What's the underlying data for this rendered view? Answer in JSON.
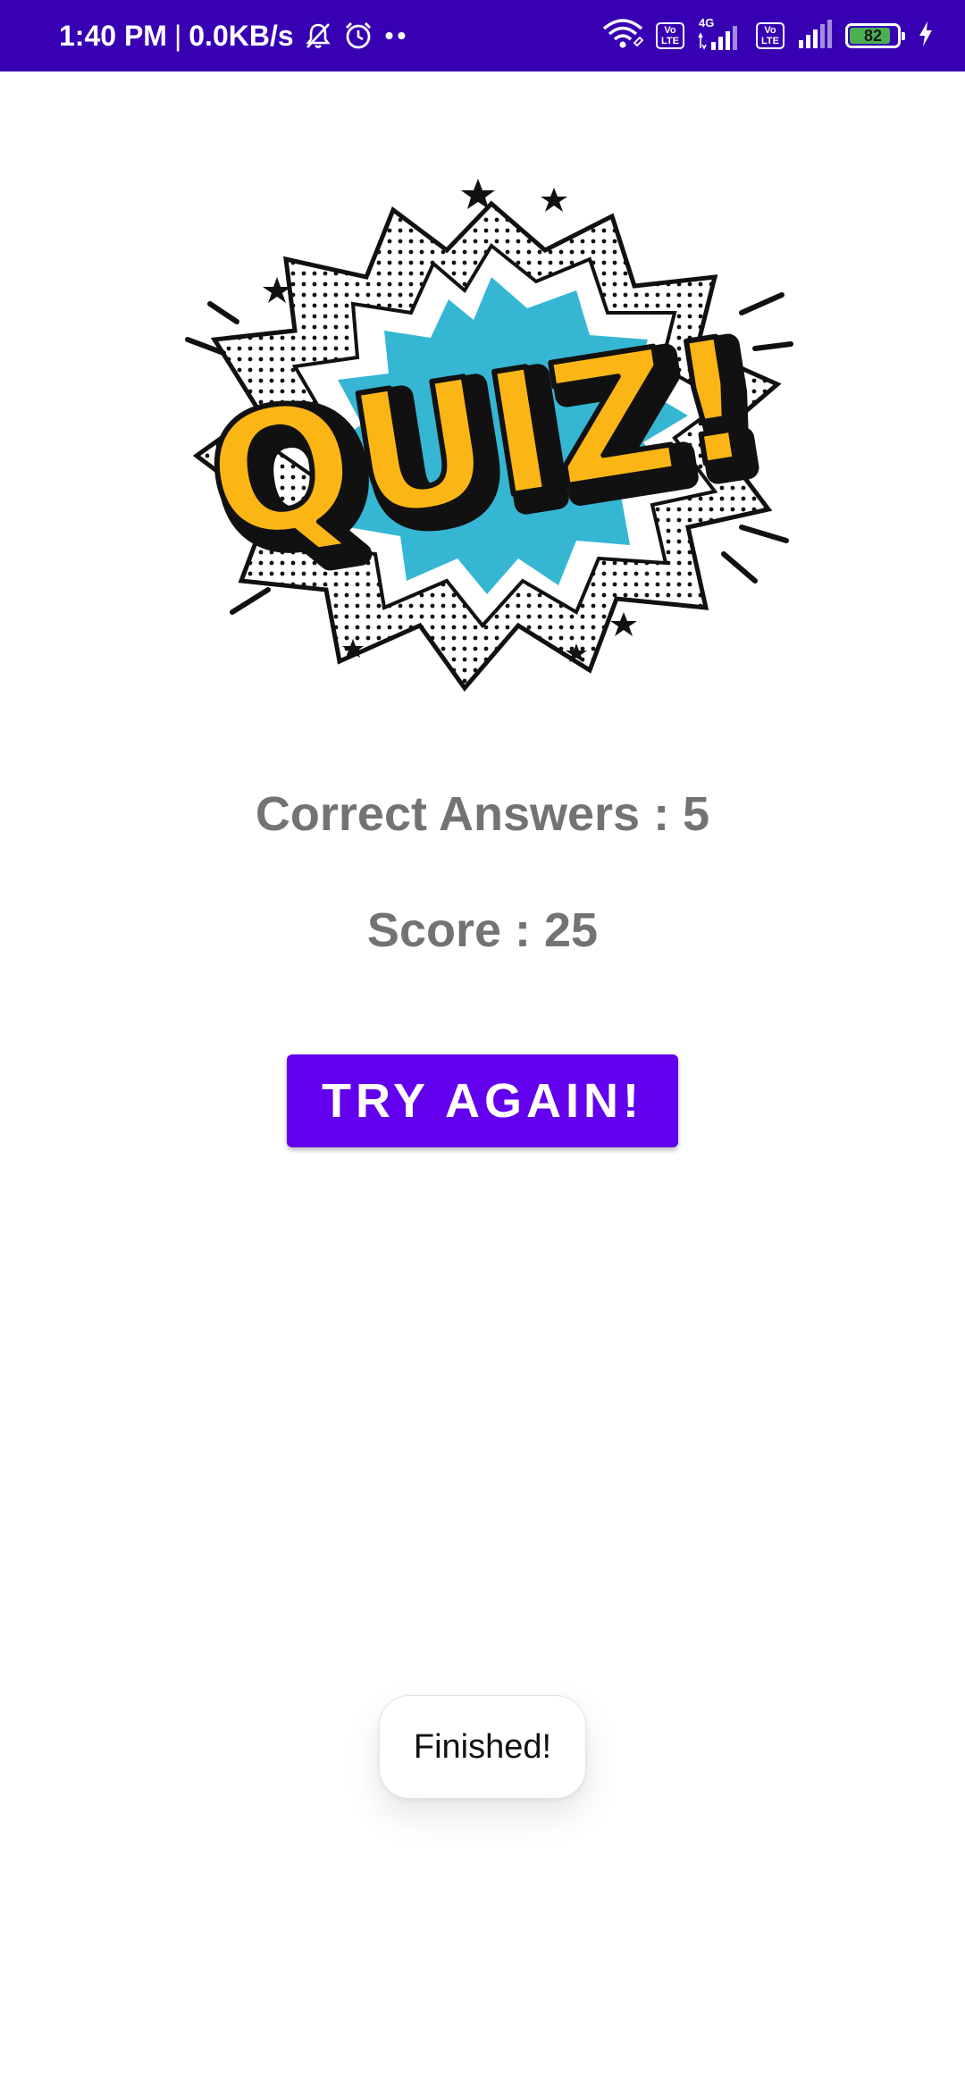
{
  "status_bar": {
    "time": "1:40 PM",
    "separator": "|",
    "speed": "0.0KB/s",
    "network_type": "4G",
    "volte_1": "Vo\nLTE",
    "volte_2": "Vo\nLTE",
    "battery_level": "82",
    "icons": [
      "mute-icon",
      "alarm-icon",
      "wifi-icon",
      "signal-icon",
      "battery-icon",
      "charging-icon"
    ],
    "background_color": "#3700b3"
  },
  "logo": {
    "text": "QUIZ!",
    "colors": {
      "letters": "#fbb616",
      "burst": "#35b7d4",
      "outline": "#111111"
    }
  },
  "results": {
    "correct_answers_label": "Correct Answers : 5",
    "score_label": "Score : 25"
  },
  "try_again_button": {
    "label": "TRY AGAIN!",
    "color": "#6200ee"
  },
  "toast": {
    "message": "Finished!"
  }
}
